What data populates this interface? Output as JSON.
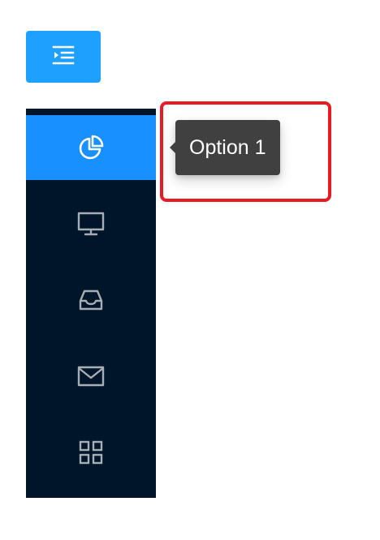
{
  "colors": {
    "toggle_button": "#1ea0ff",
    "menu_background": "#001529",
    "menu_selected": "#1890ff",
    "menu_icon": "#a6adb4",
    "tooltip_background": "#404040",
    "highlight": "#e81a24"
  },
  "toggle": {
    "icon": "menu-fold-icon"
  },
  "menu": {
    "items": [
      {
        "icon": "pie-chart-icon",
        "selected": true
      },
      {
        "icon": "desktop-icon",
        "selected": false
      },
      {
        "icon": "inbox-icon",
        "selected": false
      },
      {
        "icon": "mail-icon",
        "selected": false
      },
      {
        "icon": "appstore-icon",
        "selected": false
      }
    ]
  },
  "tooltip": {
    "text": "Option 1"
  }
}
